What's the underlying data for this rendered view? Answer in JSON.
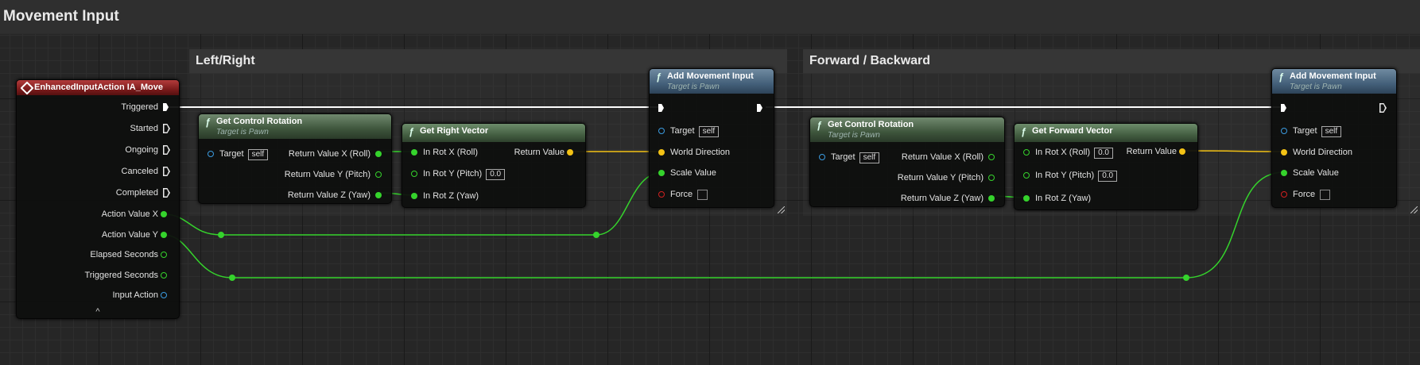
{
  "comments": {
    "main": "Movement Input",
    "left_right": "Left/Right",
    "forward_backward": "Forward / Backward"
  },
  "event_node": {
    "title": "EnhancedInputAction IA_Move",
    "pins": [
      "Triggered",
      "Started",
      "Ongoing",
      "Canceled",
      "Completed",
      "Action Value X",
      "Action Value Y",
      "Elapsed Seconds",
      "Triggered Seconds",
      "Input Action"
    ],
    "collapse_glyph": "^"
  },
  "get_control_rotation_1": {
    "title": "Get Control Rotation",
    "subtitle": "Target is Pawn",
    "target_label": "Target",
    "target_value": "self",
    "outputs": [
      "Return Value X (Roll)",
      "Return Value Y (Pitch)",
      "Return Value Z (Yaw)"
    ]
  },
  "get_right_vector": {
    "title": "Get Right Vector",
    "inputs": [
      "In Rot X (Roll)",
      "In Rot Y (Pitch)",
      "In Rot Z (Yaw)"
    ],
    "pitch_value": "0.0",
    "output": "Return Value"
  },
  "add_movement_input_1": {
    "title": "Add Movement Input",
    "subtitle": "Target is Pawn",
    "target_label": "Target",
    "target_value": "self",
    "pins": [
      "World Direction",
      "Scale Value",
      "Force"
    ]
  },
  "get_control_rotation_2": {
    "title": "Get Control Rotation",
    "subtitle": "Target is Pawn",
    "target_label": "Target",
    "target_value": "self",
    "outputs": [
      "Return Value X (Roll)",
      "Return Value Y (Pitch)",
      "Return Value Z (Yaw)"
    ]
  },
  "get_forward_vector": {
    "title": "Get Forward Vector",
    "inputs": [
      "In Rot X (Roll)",
      "In Rot Y (Pitch)",
      "In Rot Z (Yaw)"
    ],
    "roll_value": "0.0",
    "pitch_value": "0.0",
    "output": "Return Value"
  },
  "add_movement_input_2": {
    "title": "Add Movement Input",
    "subtitle": "Target is Pawn",
    "target_label": "Target",
    "target_value": "self",
    "pins": [
      "World Direction",
      "Scale Value",
      "Force"
    ]
  },
  "function_glyph": "ƒ",
  "colors": {
    "exec_wire": "#ffffff",
    "float_wire": "#35d32c",
    "vector_wire": "#f3c215",
    "event_header": "#8a1f1f",
    "function_header": "#4f6a4d",
    "object_pin": "#3b9be0"
  }
}
